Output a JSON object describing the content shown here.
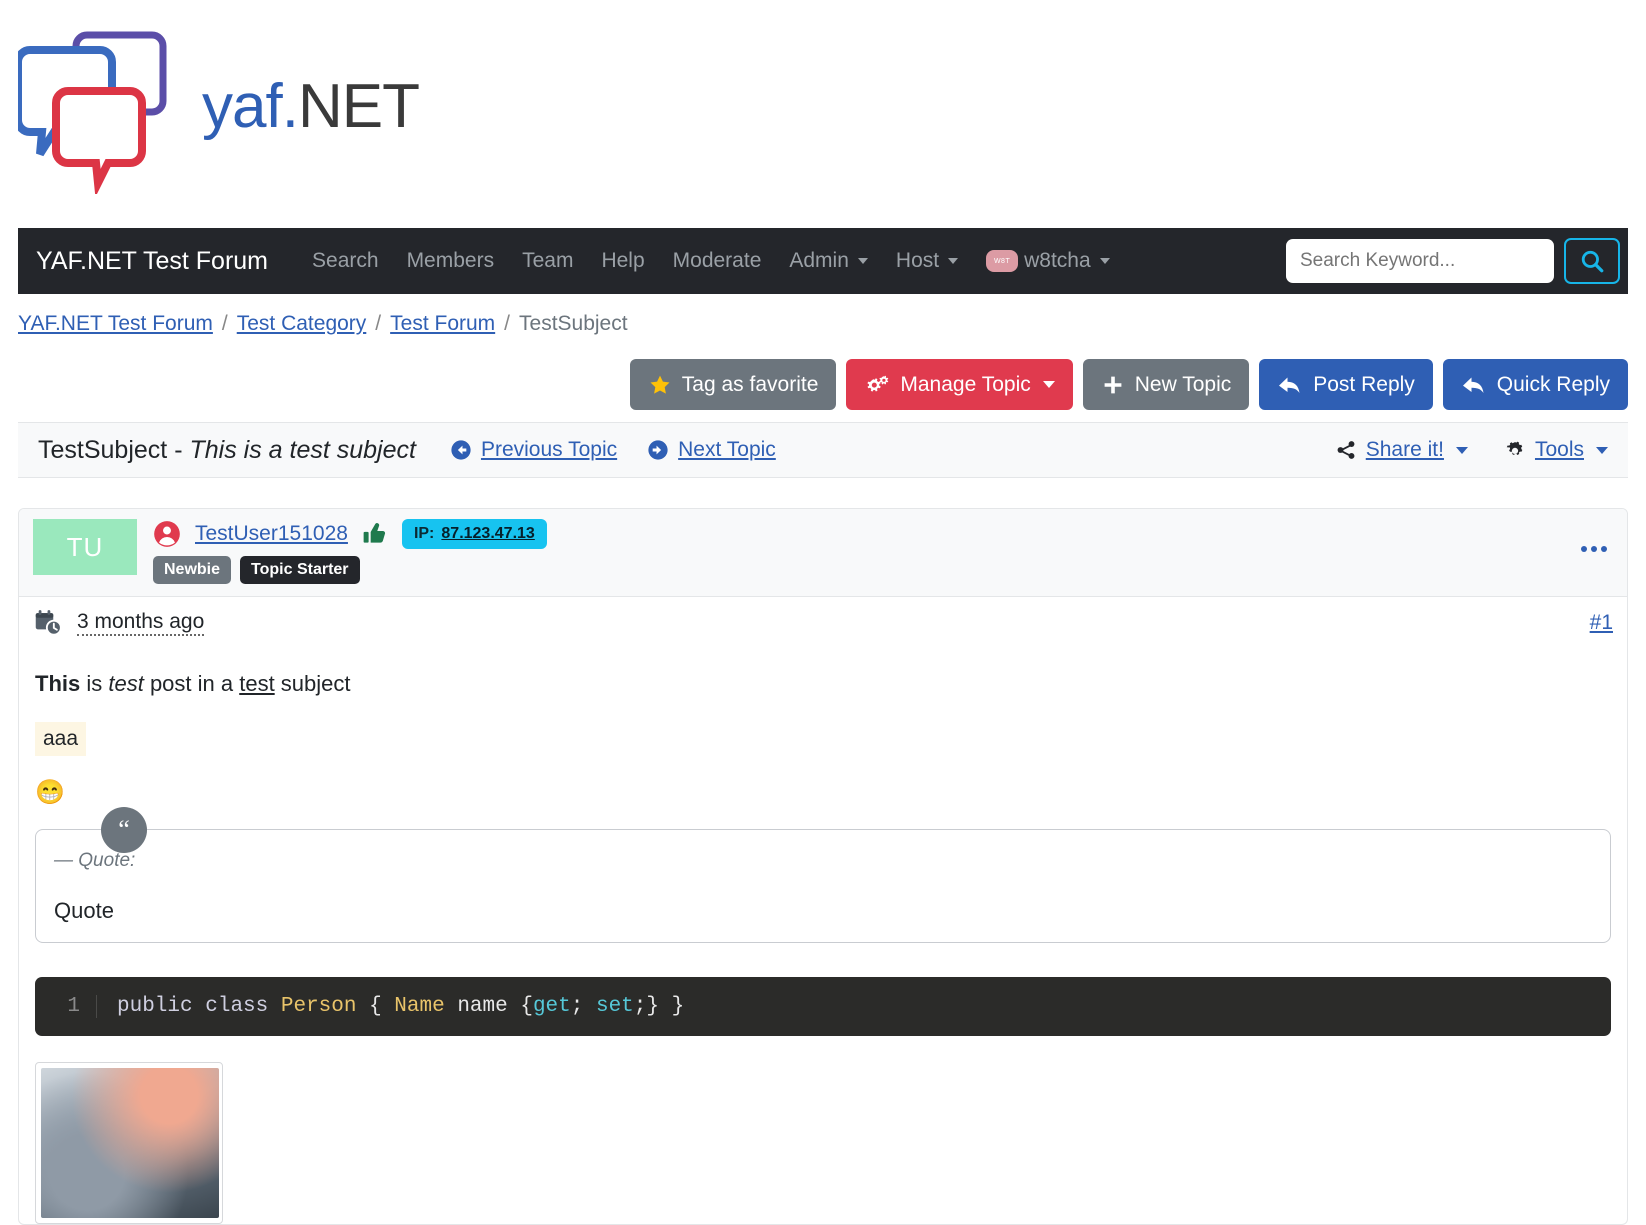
{
  "logo": {
    "text_yaf": "yaf",
    "text_dot": ".",
    "text_net": "NET",
    "alt": "yaf.NET"
  },
  "navbar": {
    "brand": "YAF.NET Test Forum",
    "links": [
      {
        "label": "Search",
        "dropdown": false
      },
      {
        "label": "Members",
        "dropdown": false
      },
      {
        "label": "Team",
        "dropdown": false
      },
      {
        "label": "Help",
        "dropdown": false
      },
      {
        "label": "Moderate",
        "dropdown": false
      },
      {
        "label": "Admin",
        "dropdown": true
      },
      {
        "label": "Host",
        "dropdown": true
      }
    ],
    "user": {
      "name": "w8tcha",
      "avatar_initials": "W8T"
    },
    "search": {
      "placeholder": "Search Keyword...",
      "value": "",
      "button_icon": "search-icon"
    }
  },
  "breadcrumb": {
    "items": [
      {
        "label": "YAF.NET Test Forum",
        "link": true
      },
      {
        "label": "Test Category",
        "link": true
      },
      {
        "label": "Test Forum",
        "link": true
      },
      {
        "label": "TestSubject",
        "link": false
      }
    ],
    "separator": "/"
  },
  "toolbar": {
    "buttons": [
      {
        "label": "Tag as favorite",
        "style": "secondary",
        "icon": "star-icon",
        "dropdown": false
      },
      {
        "label": "Manage Topic",
        "style": "danger",
        "icon": "gears-icon",
        "dropdown": true
      },
      {
        "label": "New Topic",
        "style": "secondary",
        "icon": "plus-icon",
        "dropdown": false
      },
      {
        "label": "Post Reply",
        "style": "primary",
        "icon": "reply-icon",
        "dropdown": false
      },
      {
        "label": "Quick Reply",
        "style": "primary",
        "icon": "reply-icon",
        "dropdown": false
      }
    ]
  },
  "topic": {
    "name": "TestSubject",
    "separator": " - ",
    "description": "This is a test subject",
    "prev_label": "Previous Topic",
    "next_label": "Next Topic",
    "share_label": "Share it!",
    "tools_label": "Tools"
  },
  "post": {
    "avatar_initials": "TU",
    "username": "TestUser151028",
    "ip_label": "IP:",
    "ip_value": "87.123.47.13",
    "badges": [
      "Newbie",
      "Topic Starter"
    ],
    "time": "3 months ago",
    "post_number": "#1",
    "menu_icon": "ellipsis-icon",
    "thumb_icon": "thumbs-up-icon",
    "body": {
      "line1_bold": "This",
      "line1_plain1": " is ",
      "line1_italic": "test",
      "line1_plain2": " post in a ",
      "line1_underline": "test",
      "line1_plain3": " subject",
      "highlight_text": "aaa",
      "emoji": "😁",
      "quote_cite": "— Quote:",
      "quote_text": "Quote",
      "quote_icon": "quote-icon",
      "code": {
        "line_number": "1",
        "tokens": [
          {
            "t": "public",
            "c": "kw"
          },
          {
            "t": " ",
            "c": "plain"
          },
          {
            "t": "class",
            "c": "kw"
          },
          {
            "t": " ",
            "c": "plain"
          },
          {
            "t": "Person",
            "c": "type"
          },
          {
            "t": " { ",
            "c": "plain"
          },
          {
            "t": "Name",
            "c": "type"
          },
          {
            "t": " name {",
            "c": "plain"
          },
          {
            "t": "get",
            "c": "acc"
          },
          {
            "t": "; ",
            "c": "plain"
          },
          {
            "t": "set",
            "c": "acc"
          },
          {
            "t": ";} }",
            "c": "plain"
          }
        ],
        "plain": "public class Person { Name name {get; set;} }"
      },
      "attachment_alt": "attached image thumbnail"
    }
  },
  "colors": {
    "navbar_bg": "#24262b",
    "primary": "#2f5fb4",
    "danger": "#e03a4e",
    "secondary": "#6c757d",
    "ip_badge": "#17c3f0",
    "avatar_bg": "#9ae8bd",
    "highlight": "#fdf6e3",
    "code_bg": "#2b2b29",
    "search_border": "#17b5e8"
  }
}
